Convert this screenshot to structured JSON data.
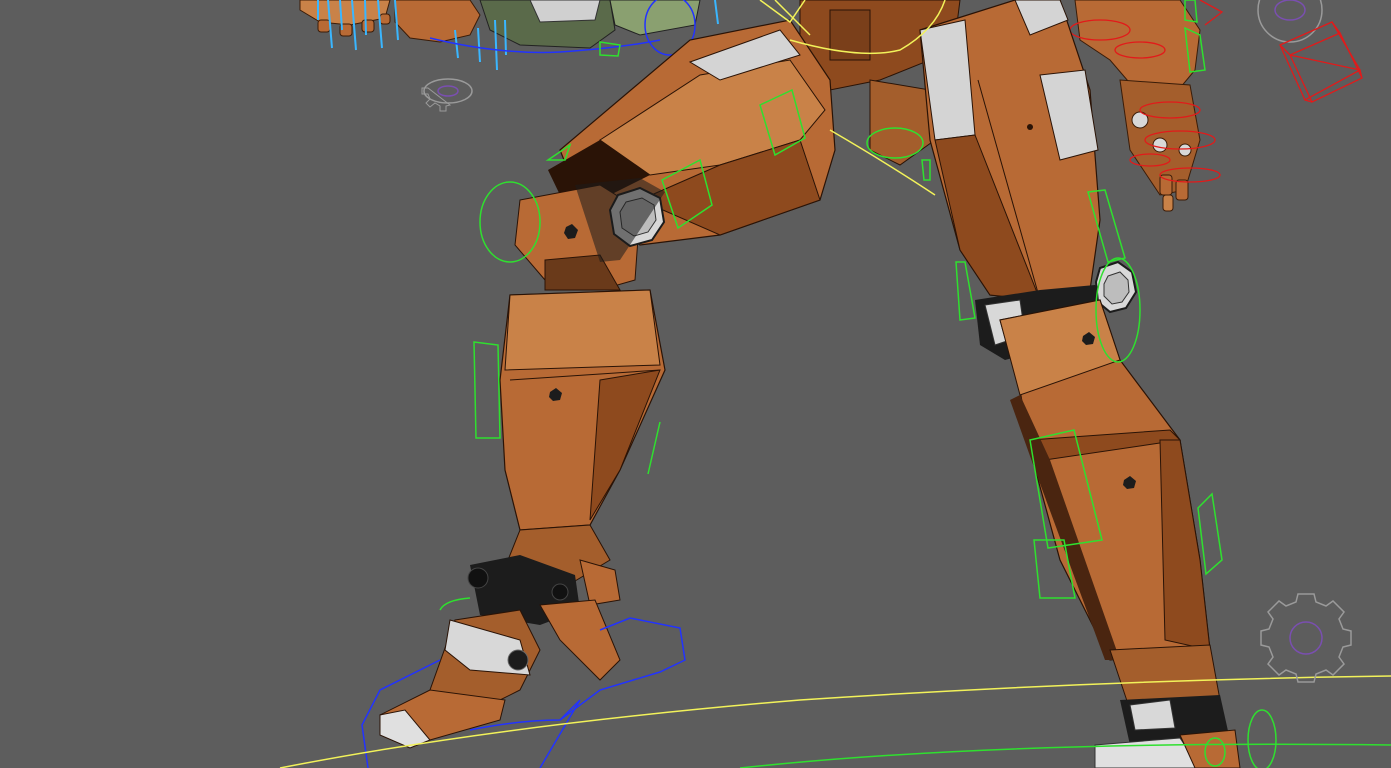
{
  "viewport": {
    "background": "#5d5d5d",
    "name": "3d-viewport"
  },
  "scene": {
    "model": "robot-mech-legs",
    "colors": {
      "armor_orange": "#b86a35",
      "armor_orange_light": "#c98248",
      "armor_orange_dark": "#7a3f1a",
      "armor_shadow": "#4a2510",
      "plate_gray": "#d4d4d4",
      "joint_dark": "#1c1c1c",
      "control_green": "#2fe02f",
      "control_blue": "#2233ff",
      "control_yellow": "#f2f25a",
      "control_red": "#e21a1a",
      "control_cyan": "#3ab6ff",
      "gizmo_gray": "#9a9a9a",
      "gizmo_purple": "#7a4fb0"
    },
    "icons": [
      "settings-gear-gizmo-icon",
      "selection-box-gizmo-icon"
    ]
  }
}
